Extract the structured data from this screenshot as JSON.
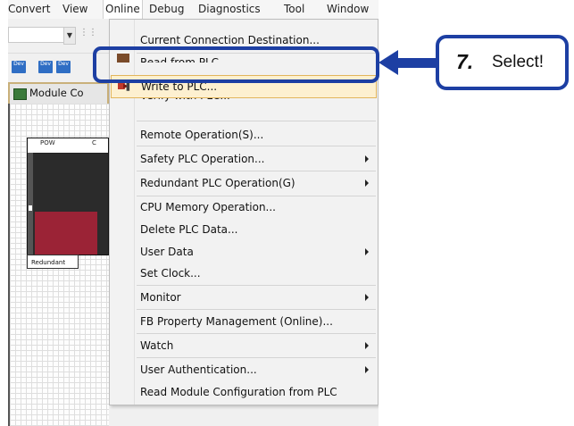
{
  "menubar": {
    "items": [
      "Convert",
      "View",
      "Online",
      "Debug",
      "Diagnostics",
      "Tool",
      "Window"
    ],
    "active": "Online"
  },
  "toolbar": {
    "dev_icon_label": "Dev"
  },
  "module_config": {
    "tab_title": "Module Co",
    "module_label": "Redundant",
    "header_left": "POW",
    "header_right": "C"
  },
  "online_menu": {
    "items": [
      {
        "label": "Current Connection Destination...",
        "submenu": false
      },
      {
        "label": "Read from PLC",
        "submenu": false,
        "partially_hidden": true
      },
      {
        "label": "Write to PLC...",
        "submenu": false,
        "highlighted": true
      },
      {
        "label": "Verify with PLC...",
        "submenu": false,
        "partially_hidden": true
      },
      {
        "label": "Remote Operation(S)...",
        "submenu": false
      },
      {
        "label": "Safety PLC Operation...",
        "submenu": true
      },
      {
        "label": "Redundant PLC Operation(G)",
        "submenu": true
      },
      {
        "label": "CPU Memory Operation...",
        "submenu": false
      },
      {
        "label": "Delete PLC Data...",
        "submenu": false
      },
      {
        "label": "User Data",
        "submenu": true
      },
      {
        "label": "Set Clock...",
        "submenu": false
      },
      {
        "label": "Monitor",
        "submenu": true
      },
      {
        "label": "FB Property Management (Online)...",
        "submenu": false
      },
      {
        "label": "Watch",
        "submenu": true
      },
      {
        "label": "User Authentication...",
        "submenu": true
      },
      {
        "label": "Read Module Configuration from PLC",
        "submenu": false
      }
    ]
  },
  "callout": {
    "step": "7.",
    "text": "Select!"
  },
  "colors": {
    "accent": "#1d3fa3",
    "highlight_bg": "#fdf0d0",
    "highlight_border": "#e2b65c",
    "module_red": "#9b2336"
  }
}
